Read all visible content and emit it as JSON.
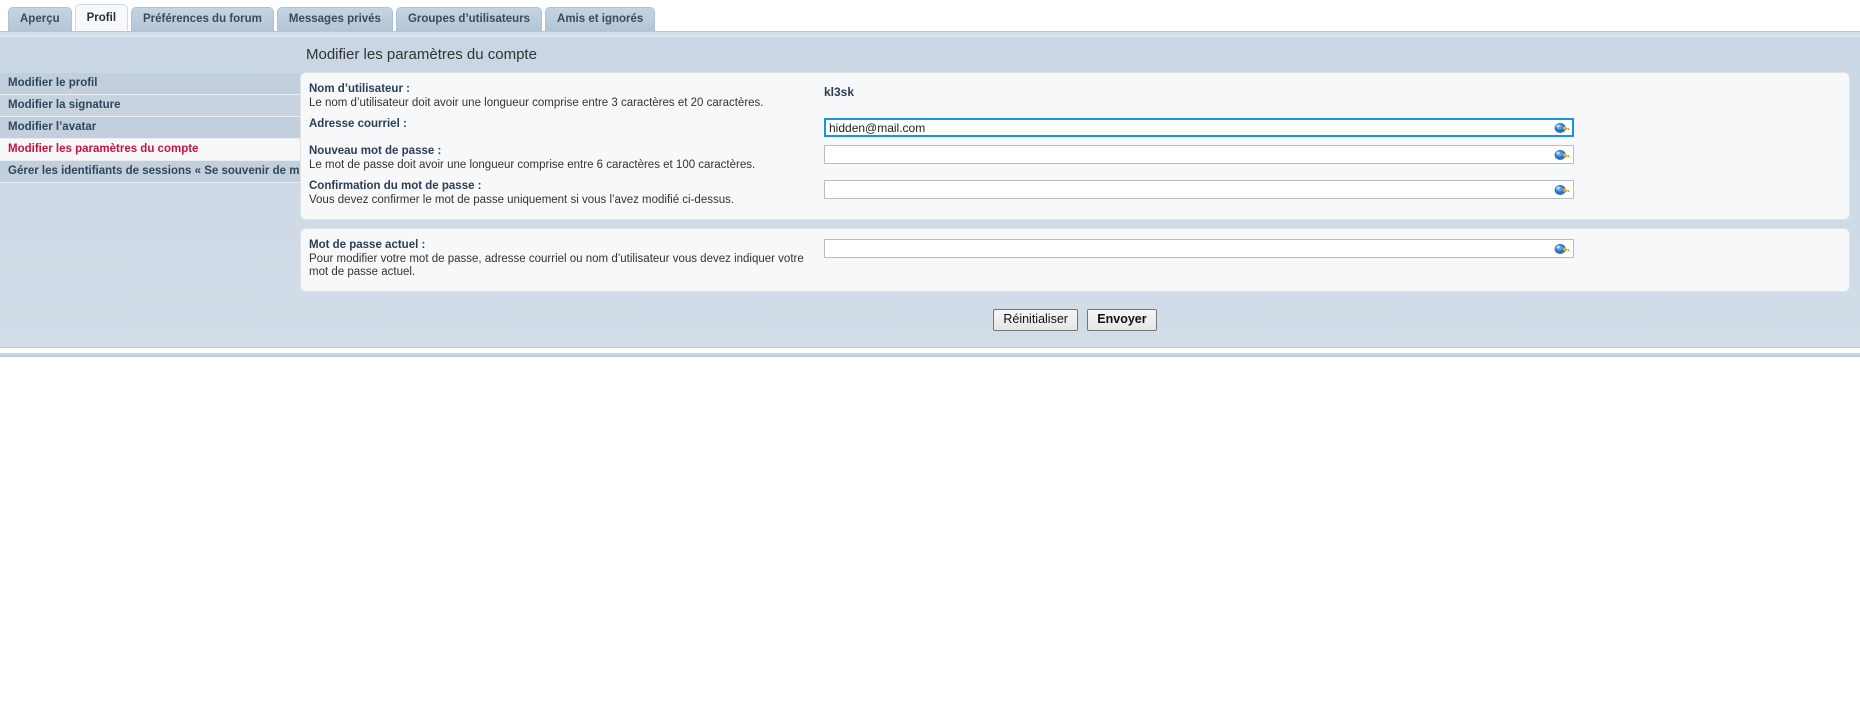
{
  "tabs": [
    {
      "label": "Aperçu",
      "active": false
    },
    {
      "label": "Profil",
      "active": true
    },
    {
      "label": "Préférences du forum",
      "active": false
    },
    {
      "label": "Messages privés",
      "active": false
    },
    {
      "label": "Groupes d’utilisateurs",
      "active": false
    },
    {
      "label": "Amis et ignorés",
      "active": false
    }
  ],
  "sidebar": {
    "items": [
      {
        "label": "Modifier le profil",
        "active": false
      },
      {
        "label": "Modifier la signature",
        "active": false
      },
      {
        "label": "Modifier l’avatar",
        "active": false
      },
      {
        "label": "Modifier les paramètres du compte",
        "active": true
      },
      {
        "label": "Gérer les identifiants de sessions « Se souvenir de moi »",
        "active": false
      }
    ]
  },
  "main": {
    "title": "Modifier les paramètres du compte",
    "fields": {
      "username": {
        "label": "Nom d’utilisateur :",
        "desc": "Le nom d’utilisateur doit avoir une longueur comprise entre 3 caractères et 20 caractères.",
        "value": "kl3sk"
      },
      "email": {
        "label": "Adresse courriel :",
        "desc": "",
        "value": "hidden@mail.com",
        "placeholder": ""
      },
      "new_password": {
        "label": "Nouveau mot de passe :",
        "desc": "Le mot de passe doit avoir une longueur comprise entre 6 caractères et 100 caractères.",
        "value": "",
        "placeholder": ""
      },
      "confirm_password": {
        "label": "Confirmation du mot de passe :",
        "desc": "Vous devez confirmer le mot de passe uniquement si vous l’avez modifié ci-dessus.",
        "value": "",
        "placeholder": ""
      },
      "current_password": {
        "label": "Mot de passe actuel :",
        "desc": "Pour modifier votre mot de passe, adresse courriel ou nom d’utilisateur vous devez indiquer votre mot de passe actuel.",
        "value": "",
        "placeholder": ""
      }
    },
    "buttons": {
      "reset": "Réinitialiser",
      "submit": "Envoyer"
    }
  },
  "icons": {
    "saved_logins": "browser-key-icon"
  },
  "colors": {
    "accent_link": "#c7133e",
    "focus_border": "#1a95dd",
    "band_bg": "#cdd9e5",
    "panel_bg": "#f7f8f9"
  }
}
